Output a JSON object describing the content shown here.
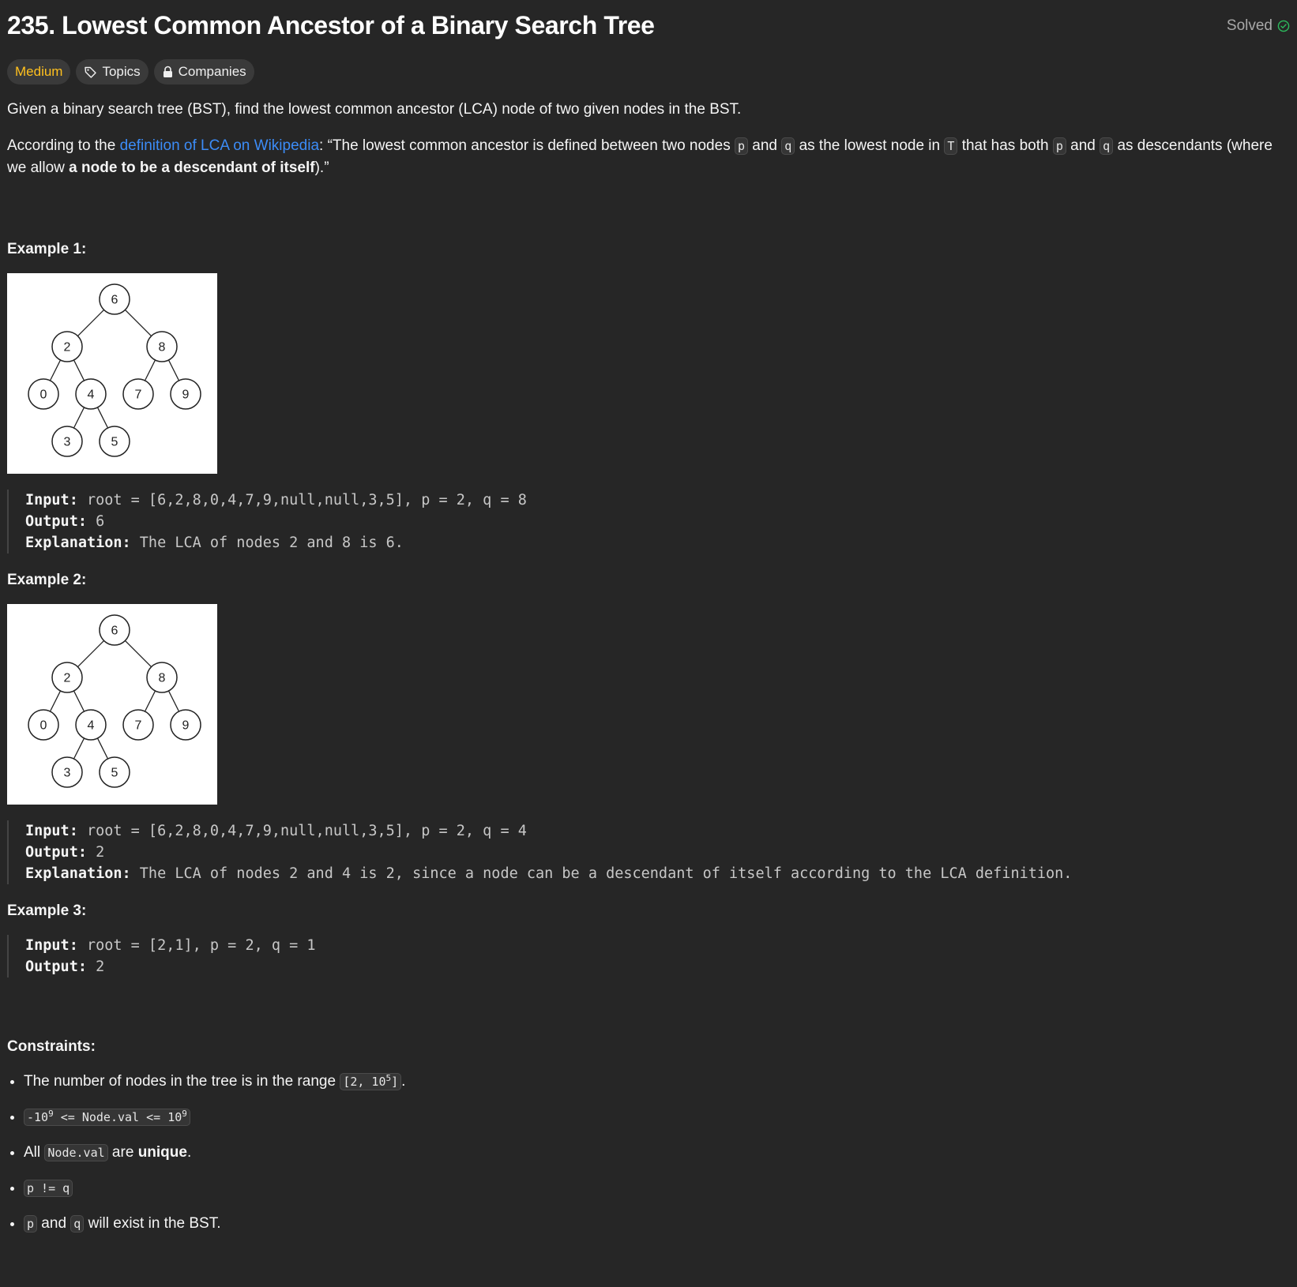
{
  "header": {
    "title": "235. Lowest Common Ancestor of a Binary Search Tree",
    "status": "Solved"
  },
  "tags": {
    "difficulty": "Medium",
    "topics": "Topics",
    "companies": "Companies"
  },
  "icons": {
    "solved": "check-circle-icon",
    "topics": "tag-icon",
    "companies": "lock-icon"
  },
  "colors": {
    "difficulty": "#ffc01e",
    "link": "#3c8cf7",
    "solved_check": "#2cbb5d",
    "background": "#262626"
  },
  "description": {
    "p1": "Given a binary search tree (BST), find the lowest common ancestor (LCA) node of two given nodes in the BST.",
    "p2_before_link": "According to the ",
    "p2_link": "definition of LCA on Wikipedia",
    "p2_after_link": ": “The lowest common ancestor is defined between two nodes ",
    "code_p": "p",
    "and": " and ",
    "code_q": "q",
    "p2_mid1": " as the lowest node in ",
    "code_T": "T",
    "p2_mid2": " that has both ",
    "p2_mid3": " as descendants (where we allow ",
    "p2_bold": "a node to be a descendant of itself",
    "p2_end": ").”"
  },
  "tree": {
    "nodes": [
      "6",
      "2",
      "8",
      "0",
      "4",
      "7",
      "9",
      "3",
      "5"
    ]
  },
  "examples": [
    {
      "heading": "Example 1:",
      "input_label": "Input:",
      "input_value": " root = [6,2,8,0,4,7,9,null,null,3,5], p = 2, q = 8",
      "output_label": "Output:",
      "output_value": " 6",
      "explanation_label": "Explanation:",
      "explanation_value": " The LCA of nodes 2 and 8 is 6."
    },
    {
      "heading": "Example 2:",
      "input_label": "Input:",
      "input_value": " root = [6,2,8,0,4,7,9,null,null,3,5], p = 2, q = 4",
      "output_label": "Output:",
      "output_value": " 2",
      "explanation_label": "Explanation:",
      "explanation_value": " The LCA of nodes 2 and 4 is 2, since a node can be a descendant of itself according to the LCA definition."
    },
    {
      "heading": "Example 3:",
      "input_label": "Input:",
      "input_value": " root = [2,1], p = 2, q = 1",
      "output_label": "Output:",
      "output_value": " 2"
    }
  ],
  "constraints": {
    "heading": "Constraints:",
    "c1_text": "The number of nodes in the tree is in the range ",
    "c1_code_a": "[2, 10",
    "c1_sup": "5",
    "c1_code_b": "]",
    "c1_end": ".",
    "c2_a": "-10",
    "c2_sup1": "9",
    "c2_b": " <= Node.val <= 10",
    "c2_sup2": "9",
    "c3_a": "All ",
    "c3_code": "Node.val",
    "c3_b": " are ",
    "c3_bold": "unique",
    "c3_end": ".",
    "c4_code": "p != q",
    "c5_p": "p",
    "c5_and": " and ",
    "c5_q": "q",
    "c5_end": " will exist in the BST."
  }
}
